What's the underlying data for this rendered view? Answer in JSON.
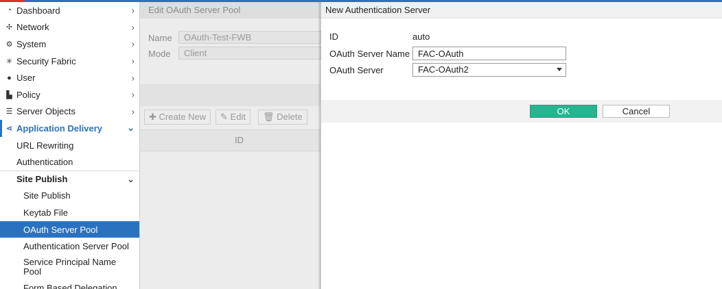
{
  "sidebar": {
    "items": [
      {
        "label": "Dashboard",
        "icon": "dashboard-icon",
        "chevron": "›"
      },
      {
        "label": "Network",
        "icon": "network-icon",
        "chevron": "›"
      },
      {
        "label": "System",
        "icon": "gear-icon",
        "chevron": "›"
      },
      {
        "label": "Security Fabric",
        "icon": "security-fabric-icon",
        "chevron": "›"
      },
      {
        "label": "User",
        "icon": "user-icon",
        "chevron": "›"
      },
      {
        "label": "Policy",
        "icon": "policy-icon",
        "chevron": "›"
      },
      {
        "label": "Server Objects",
        "icon": "server-objects-icon",
        "chevron": "›"
      },
      {
        "label": "Application Delivery",
        "icon": "application-delivery-icon",
        "chevron": "⌄"
      }
    ],
    "sub_items": [
      {
        "label": "URL Rewriting"
      },
      {
        "label": "Authentication"
      }
    ],
    "group": {
      "label": "Site Publish",
      "chevron": "⌄"
    },
    "group_items": [
      {
        "label": "Site Publish"
      },
      {
        "label": "Keytab File"
      },
      {
        "label": "OAuth Server Pool"
      },
      {
        "label": "Authentication Server Pool"
      },
      {
        "label": "Service Principal Name Pool"
      },
      {
        "label": "Form Based Delegation"
      }
    ]
  },
  "background_panel": {
    "title": "Edit OAuth Server Pool",
    "name_label": "Name",
    "name_value": "OAuth-Test-FWB",
    "mode_label": "Mode",
    "mode_value": "Client",
    "create_new_label": "Create New",
    "edit_label": "Edit",
    "delete_label": "Delete",
    "id_column": "ID"
  },
  "dialog": {
    "title": "New Authentication Server",
    "id_label": "ID",
    "id_value": "auto",
    "server_name_label": "OAuth Server Name",
    "server_name_value": "FAC-OAuth",
    "server_label": "OAuth Server",
    "server_value": "FAC-OAuth2",
    "ok_label": "OK",
    "cancel_label": "Cancel"
  },
  "colors": {
    "accent": "#2a72c0",
    "ok_button": "#27b48f"
  }
}
